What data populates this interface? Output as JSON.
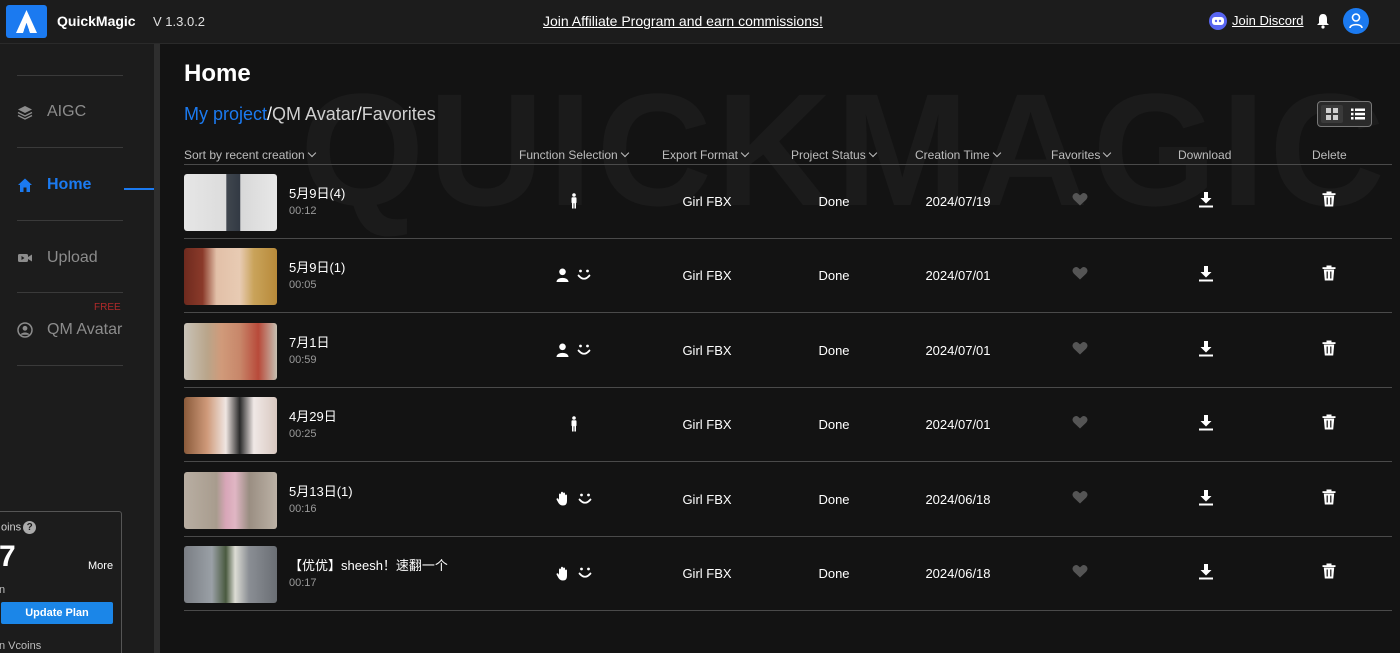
{
  "app": {
    "name": "QuickMagic",
    "version": "V 1.3.0.2"
  },
  "topbar": {
    "affiliate_link": "Join Affiliate Program and earn commissions!",
    "discord_link": "Join Discord"
  },
  "sidebar": {
    "items": [
      {
        "label": "AIGC",
        "icon": "layers-icon"
      },
      {
        "label": "Home",
        "icon": "home-icon",
        "active": true
      },
      {
        "label": "Upload",
        "icon": "video-icon"
      },
      {
        "label": "QM Avatar",
        "icon": "avatar-icon",
        "tag": "FREE"
      }
    ],
    "vcoins": {
      "title": "oins",
      "number": "7",
      "more_label": "More",
      "sub_text": "n",
      "update_button": "Update Plan",
      "footer_text": "n Vcoins"
    }
  },
  "watermark": "QUICKMAGIC",
  "main": {
    "title": "Home",
    "breadcrumb": {
      "active": "My project",
      "separator": "/",
      "second": "QM Avatar",
      "third": "Favorites"
    },
    "columns": {
      "sort": "Sort by recent creation",
      "function": "Function Selection",
      "format": "Export Format",
      "status": "Project Status",
      "time": "Creation Time",
      "favorites": "Favorites",
      "download": "Download",
      "delete": "Delete"
    },
    "rows": [
      {
        "name": "5月9日(4)",
        "duration": "00:12",
        "functions": [
          "body-icon"
        ],
        "format": "Girl FBX",
        "status": "Done",
        "date": "2024/07/19"
      },
      {
        "name": "5月9日(1)",
        "duration": "00:05",
        "functions": [
          "person-icon",
          "face-icon"
        ],
        "format": "Girl FBX",
        "status": "Done",
        "date": "2024/07/01"
      },
      {
        "name": "7月1日",
        "duration": "00:59",
        "functions": [
          "person-icon",
          "face-icon"
        ],
        "format": "Girl FBX",
        "status": "Done",
        "date": "2024/07/01"
      },
      {
        "name": "4月29日",
        "duration": "00:25",
        "functions": [
          "body-icon"
        ],
        "format": "Girl FBX",
        "status": "Done",
        "date": "2024/07/01"
      },
      {
        "name": "5月13日(1)",
        "duration": "00:16",
        "functions": [
          "hand-icon",
          "face-icon"
        ],
        "format": "Girl FBX",
        "status": "Done",
        "date": "2024/06/18"
      },
      {
        "name": "【优优】sheesh！速翻一个",
        "duration": "00:17",
        "functions": [
          "hand-icon",
          "face-icon"
        ],
        "format": "Girl FBX",
        "status": "Done",
        "date": "2024/06/18"
      }
    ]
  },
  "colors": {
    "accent": "#1b7af0",
    "background": "#131313",
    "sidebar": "#1c1c1c",
    "free_tag": "#b12a2a"
  }
}
